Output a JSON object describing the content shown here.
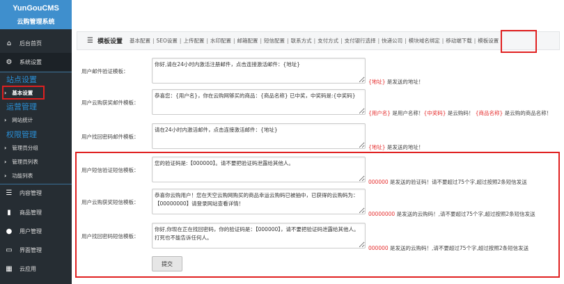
{
  "logo": {
    "brand": "YunGouCMS",
    "subtitle": "云购管理系统"
  },
  "sidebar": {
    "top": [
      {
        "label": "后台首页",
        "icon": "home-icon"
      },
      {
        "label": "系统设置",
        "icon": "gear-icon"
      }
    ],
    "sections": [
      {
        "title": "站点设置",
        "items": [
          "基本设置"
        ]
      },
      {
        "title": "运营管理",
        "items": [
          "网站统计"
        ]
      },
      {
        "title": "权限管理",
        "items": [
          "管理员分组",
          "管理员列表",
          "功能列表"
        ]
      }
    ],
    "bottom": [
      {
        "label": "内容管理",
        "icon": "list-icon"
      },
      {
        "label": "商品管理",
        "icon": "bar-chart-icon"
      },
      {
        "label": "用户管理",
        "icon": "user-icon"
      },
      {
        "label": "界面管理",
        "icon": "monitor-icon"
      },
      {
        "label": "云应用",
        "icon": "grid-icon"
      }
    ]
  },
  "header": {
    "title": "模板设置",
    "tabs": [
      "基本配置",
      "SEO设置",
      "上传配置",
      "水印配置",
      "邮箱配置",
      "短信配置",
      "联系方式",
      "支付方式",
      "支付银行选择",
      "快递公司",
      "模块域名绑定",
      "移动端下载",
      "模板设置"
    ]
  },
  "form": {
    "rows": [
      {
        "label": "用户邮件验证模板：",
        "value": "你好,请在24小时内激活注册邮件，点击连接激活邮件：{地址}",
        "hint": [
          {
            "t": "{地址}",
            "red": true
          },
          {
            "t": " 是发送的地址！",
            "red": false
          }
        ]
      },
      {
        "label": "用户云购获奖邮件模板：",
        "value": "恭喜您：{用户名}，你在云购网够买的商品：{商品名称} 已中奖，中奖码是:{中奖码}",
        "hint": [
          {
            "t": "{用户名}",
            "red": true
          },
          {
            "t": " 是用户名称！",
            "red": false
          },
          {
            "t": "{中奖码}",
            "red": true
          },
          {
            "t": " 是云购码！ ",
            "red": false
          },
          {
            "t": "{商品名称}",
            "red": true
          },
          {
            "t": " 是云购的商品名称！",
            "red": false
          }
        ]
      },
      {
        "label": "用户找回密码邮件模板：",
        "value": "请在24小时内激活邮件，点击连接激活邮件：{地址}",
        "hint": [
          {
            "t": "{地址}",
            "red": true
          },
          {
            "t": " 是发送的地址！",
            "red": false
          }
        ]
      },
      {
        "label": "用户短信验证短信模板：",
        "value": "您的验证码是:【000000】。请不要把验证码泄露给其他人。",
        "hint": [
          {
            "t": "000000",
            "red": true
          },
          {
            "t": " 是发送的验证码！请不要超过75个字,超过按照2条短信发送",
            "red": false
          }
        ]
      },
      {
        "label": "用户云购获奖短信模板：",
        "value": "恭喜你云购用户！您在天空云购网购买的商品幸运云购码已被抽中，已获得的云购码为：【00000000】请登录网站查看详情！",
        "hint": [
          {
            "t": "00000000",
            "red": true
          },
          {
            "t": " 是发送的云购码！,请不要超过75个字,超过按照2条短信发送",
            "red": false
          }
        ]
      },
      {
        "label": "用户找回密码短信模板：",
        "value": "你好,你现在正在找回密码，你的验证码是：【000000】，请不要把验证码泄露给其他人。打死也不能告诉任何人。",
        "hint": [
          {
            "t": "000000",
            "red": true
          },
          {
            "t": " 是发送的云购码！,请不要超过75个字,超过按照2条短信发送",
            "red": false
          }
        ]
      }
    ],
    "submit": "提交"
  },
  "colors": {
    "sidebar": "#262d33",
    "logo_bg": "#3f8fcd",
    "section_title": "#2a8fd6",
    "highlight": "#e02020",
    "hint_red": "#e52c2c"
  }
}
